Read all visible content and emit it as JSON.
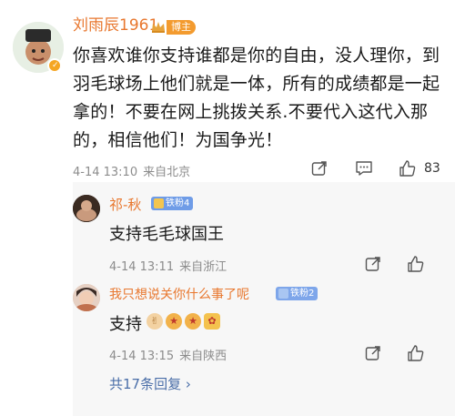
{
  "comment": {
    "author": "刘雨辰1961",
    "badge": "博主",
    "text": "你喜欢谁你支持谁都是你的自由，没人理你，到羽毛球场上他们就是一体，所有的成绩都是一起拿的！不要在网上挑拨关系.不要代入这代入那的，相信他们！为国争光！",
    "time": "4-14 13:10",
    "location": "来自北京",
    "like_count": "83"
  },
  "replies": [
    {
      "author": "祁-秋",
      "fan_badge": "铁粉4",
      "text": "支持毛毛球国王",
      "time": "4-14 13:11",
      "location": "来自浙江"
    },
    {
      "author": "我只想说关你什么事了呢",
      "fan_badge": "铁粉2",
      "text": "支持",
      "time": "4-14 13:15",
      "location": "来自陕西"
    }
  ],
  "more_replies_label": "共17条回复 ›",
  "colors": {
    "username": "#e8772e",
    "link": "#4a6ea8",
    "meta": "#8c8c8c",
    "panel_bg": "#f7f7f7",
    "fan_badge": "#6f9ce7"
  },
  "icons": [
    "share-icon",
    "comment-icon",
    "like-icon",
    "verified-icon",
    "crown-icon"
  ]
}
